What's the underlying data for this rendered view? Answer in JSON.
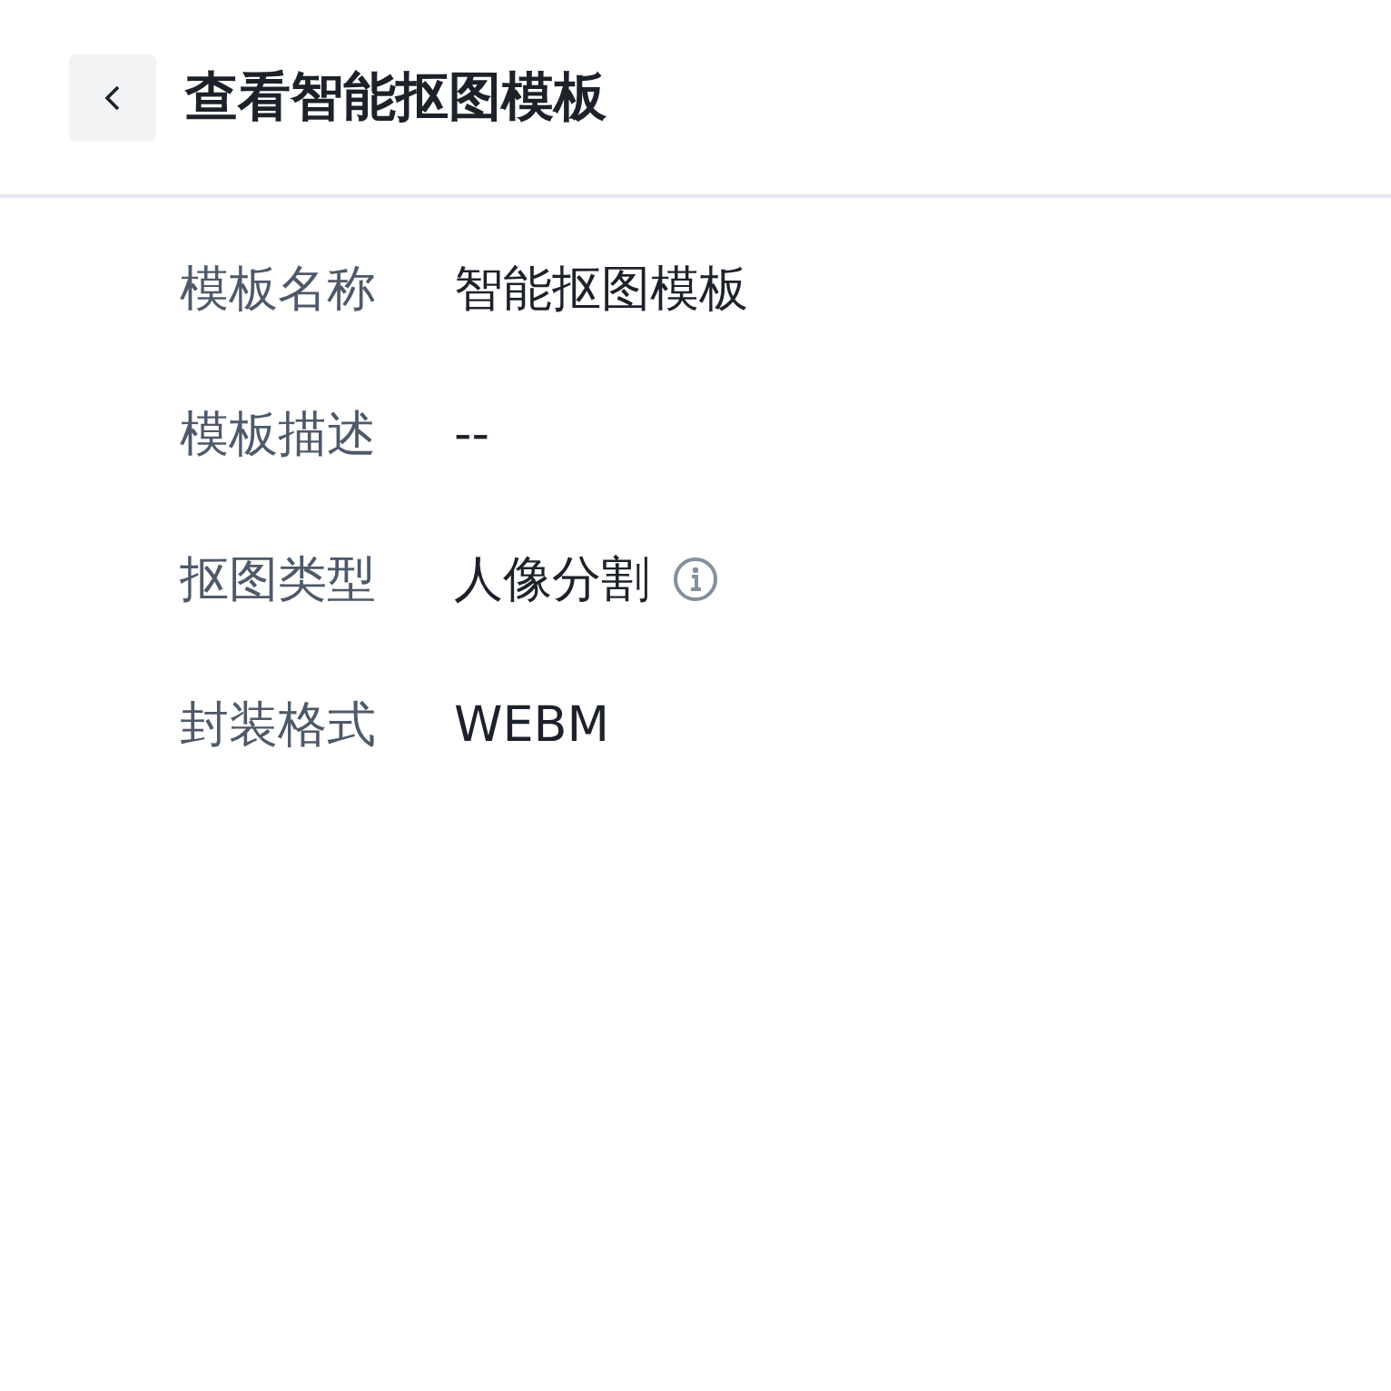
{
  "header": {
    "title": "查看智能抠图模板"
  },
  "fields": [
    {
      "label": "模板名称",
      "value": "智能抠图模板",
      "info": false
    },
    {
      "label": "模板描述",
      "value": "--",
      "info": false
    },
    {
      "label": "抠图类型",
      "value": "人像分割",
      "info": true
    },
    {
      "label": "封装格式",
      "value": "WEBM",
      "info": false
    }
  ]
}
